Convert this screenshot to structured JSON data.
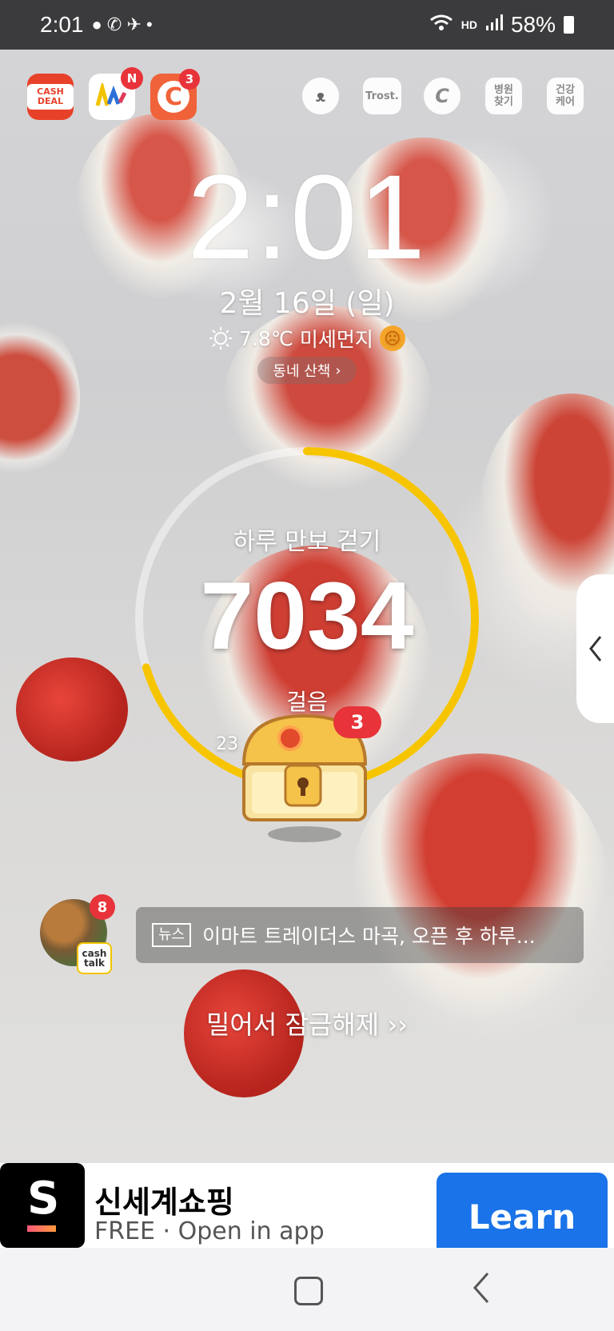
{
  "status_bar": {
    "time": "2:01",
    "battery": "58%",
    "network_label": "HD"
  },
  "app_shortcuts": [
    {
      "name": "cash-deal",
      "label": "CASH DEAL",
      "color": "#e8412a"
    },
    {
      "name": "n-app",
      "label": "",
      "badge": "N",
      "color": "#ffffff"
    },
    {
      "name": "cashwalk",
      "label": "C",
      "badge": "3",
      "color": "#f0623a"
    }
  ],
  "quick_icons": [
    {
      "name": "cat-app",
      "label": ""
    },
    {
      "name": "trost",
      "label": "Trost."
    },
    {
      "name": "c-coin",
      "label": "C"
    },
    {
      "name": "hospital-finder",
      "label": "병원\n찾기"
    },
    {
      "name": "health-care",
      "label": "건강\n케어"
    }
  ],
  "lock_clock": {
    "time": "2:01"
  },
  "date": "2월 16일 (일)",
  "weather": {
    "temp": "7.8℃",
    "air": "미세먼지",
    "icon": "sun-icon"
  },
  "walk_button": "동네 산책",
  "step_widget": {
    "title": "하루 만보 걷기",
    "steps": "7034",
    "unit": "걸음",
    "sub": "23",
    "progress": 0.7034,
    "chest_badge": "3",
    "ring_color": "#f7c500"
  },
  "news": {
    "avatar_badge": "8",
    "cash_talk": "cash talk",
    "tag": "뉴스",
    "headline": "이마트 트레이더스 마곡, 오픈 후 하루..."
  },
  "unlock_text": "밀어서 잠금해제",
  "ad": {
    "title": "신세계쇼핑",
    "subtitle": "FREE · Open in app",
    "button": "Learn"
  }
}
